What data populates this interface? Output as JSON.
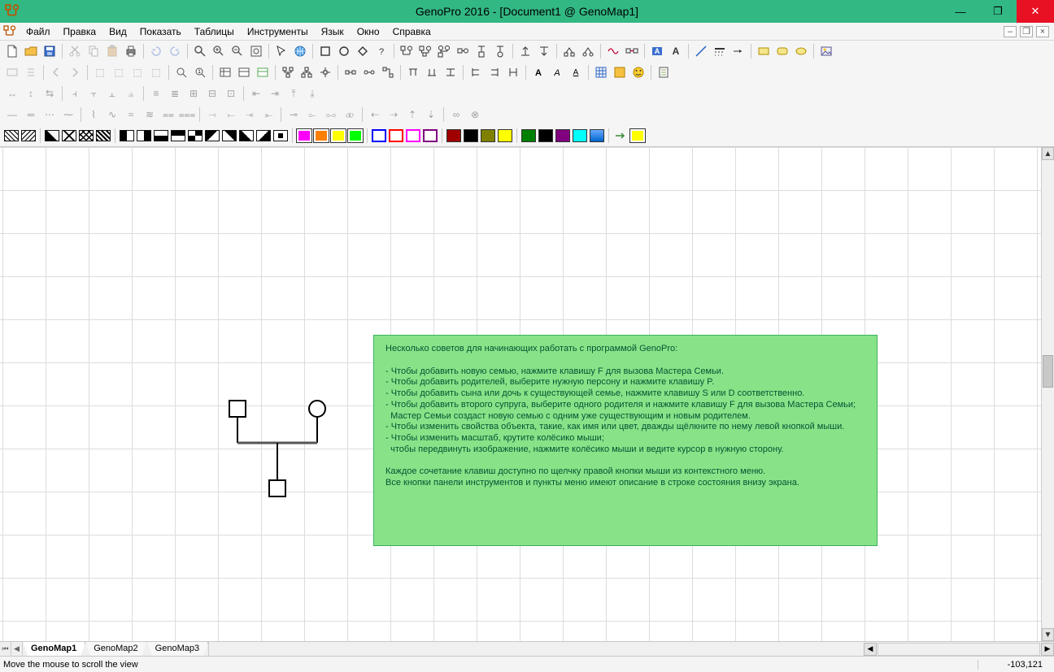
{
  "window": {
    "title": "GenoPro 2016 - [Document1 @ GenoMap1]"
  },
  "menu": {
    "items": [
      "Файл",
      "Правка",
      "Вид",
      "Показать",
      "Таблицы",
      "Инструменты",
      "Язык",
      "Окно",
      "Справка"
    ]
  },
  "tabs": {
    "items": [
      "GenoMap1",
      "GenoMap2",
      "GenoMap3"
    ],
    "active": 0
  },
  "hint": {
    "text": "Несколько советов для начинающих работать с программой GenoPro:\n\n- Чтобы добавить новую семью, нажмите клавишу F для вызова Мастера Семьи.\n- Чтобы добавить родителей, выберите нужную персону и нажмите клавишу P.\n- Чтобы добавить сына или дочь к существующей семье, нажмите клавишу S или D соответственно.\n- Чтобы добавить второго супруга, выберите одного родителя и нажмите клавишу F для вызова Мастера Семьи;\n  Мастер Семьи создаст новую семью с одним уже существующим и новым родителем.\n- Чтобы изменить свойства объекта, такие, как имя или цвет, дважды щёлкните по нему левой кнопкой мыши.\n- Чтобы изменить масштаб, крутите колёсико мыши;\n  чтобы передвинуть изображение, нажмите колёсико мыши и ведите курсор в нужную сторону.\n\nКаждое сочетание клавиш доступно по щелчку правой кнопки мыши из контекстного меню.\nВсе кнопки панели инструментов и пункты меню имеют описание в строке состояния внизу экрана."
  },
  "status": {
    "text": "Move the mouse to scroll the view",
    "coords": "-103,121"
  },
  "colors": {
    "row5_set1": [
      "#ffffff",
      "#000000",
      "#ff00ff",
      "#ff8000",
      "#ffff00",
      "#00ff00"
    ],
    "row5_set2": [
      "#0000ff",
      "#ff0000",
      "#ff00ff",
      "#800080"
    ],
    "row5_set3": [
      "#800000",
      "#000000",
      "#808000",
      "#ffff00"
    ],
    "row5_set4": [
      "#008000",
      "#000000",
      "#800080",
      "#00ffff",
      "#0000ff"
    ]
  }
}
